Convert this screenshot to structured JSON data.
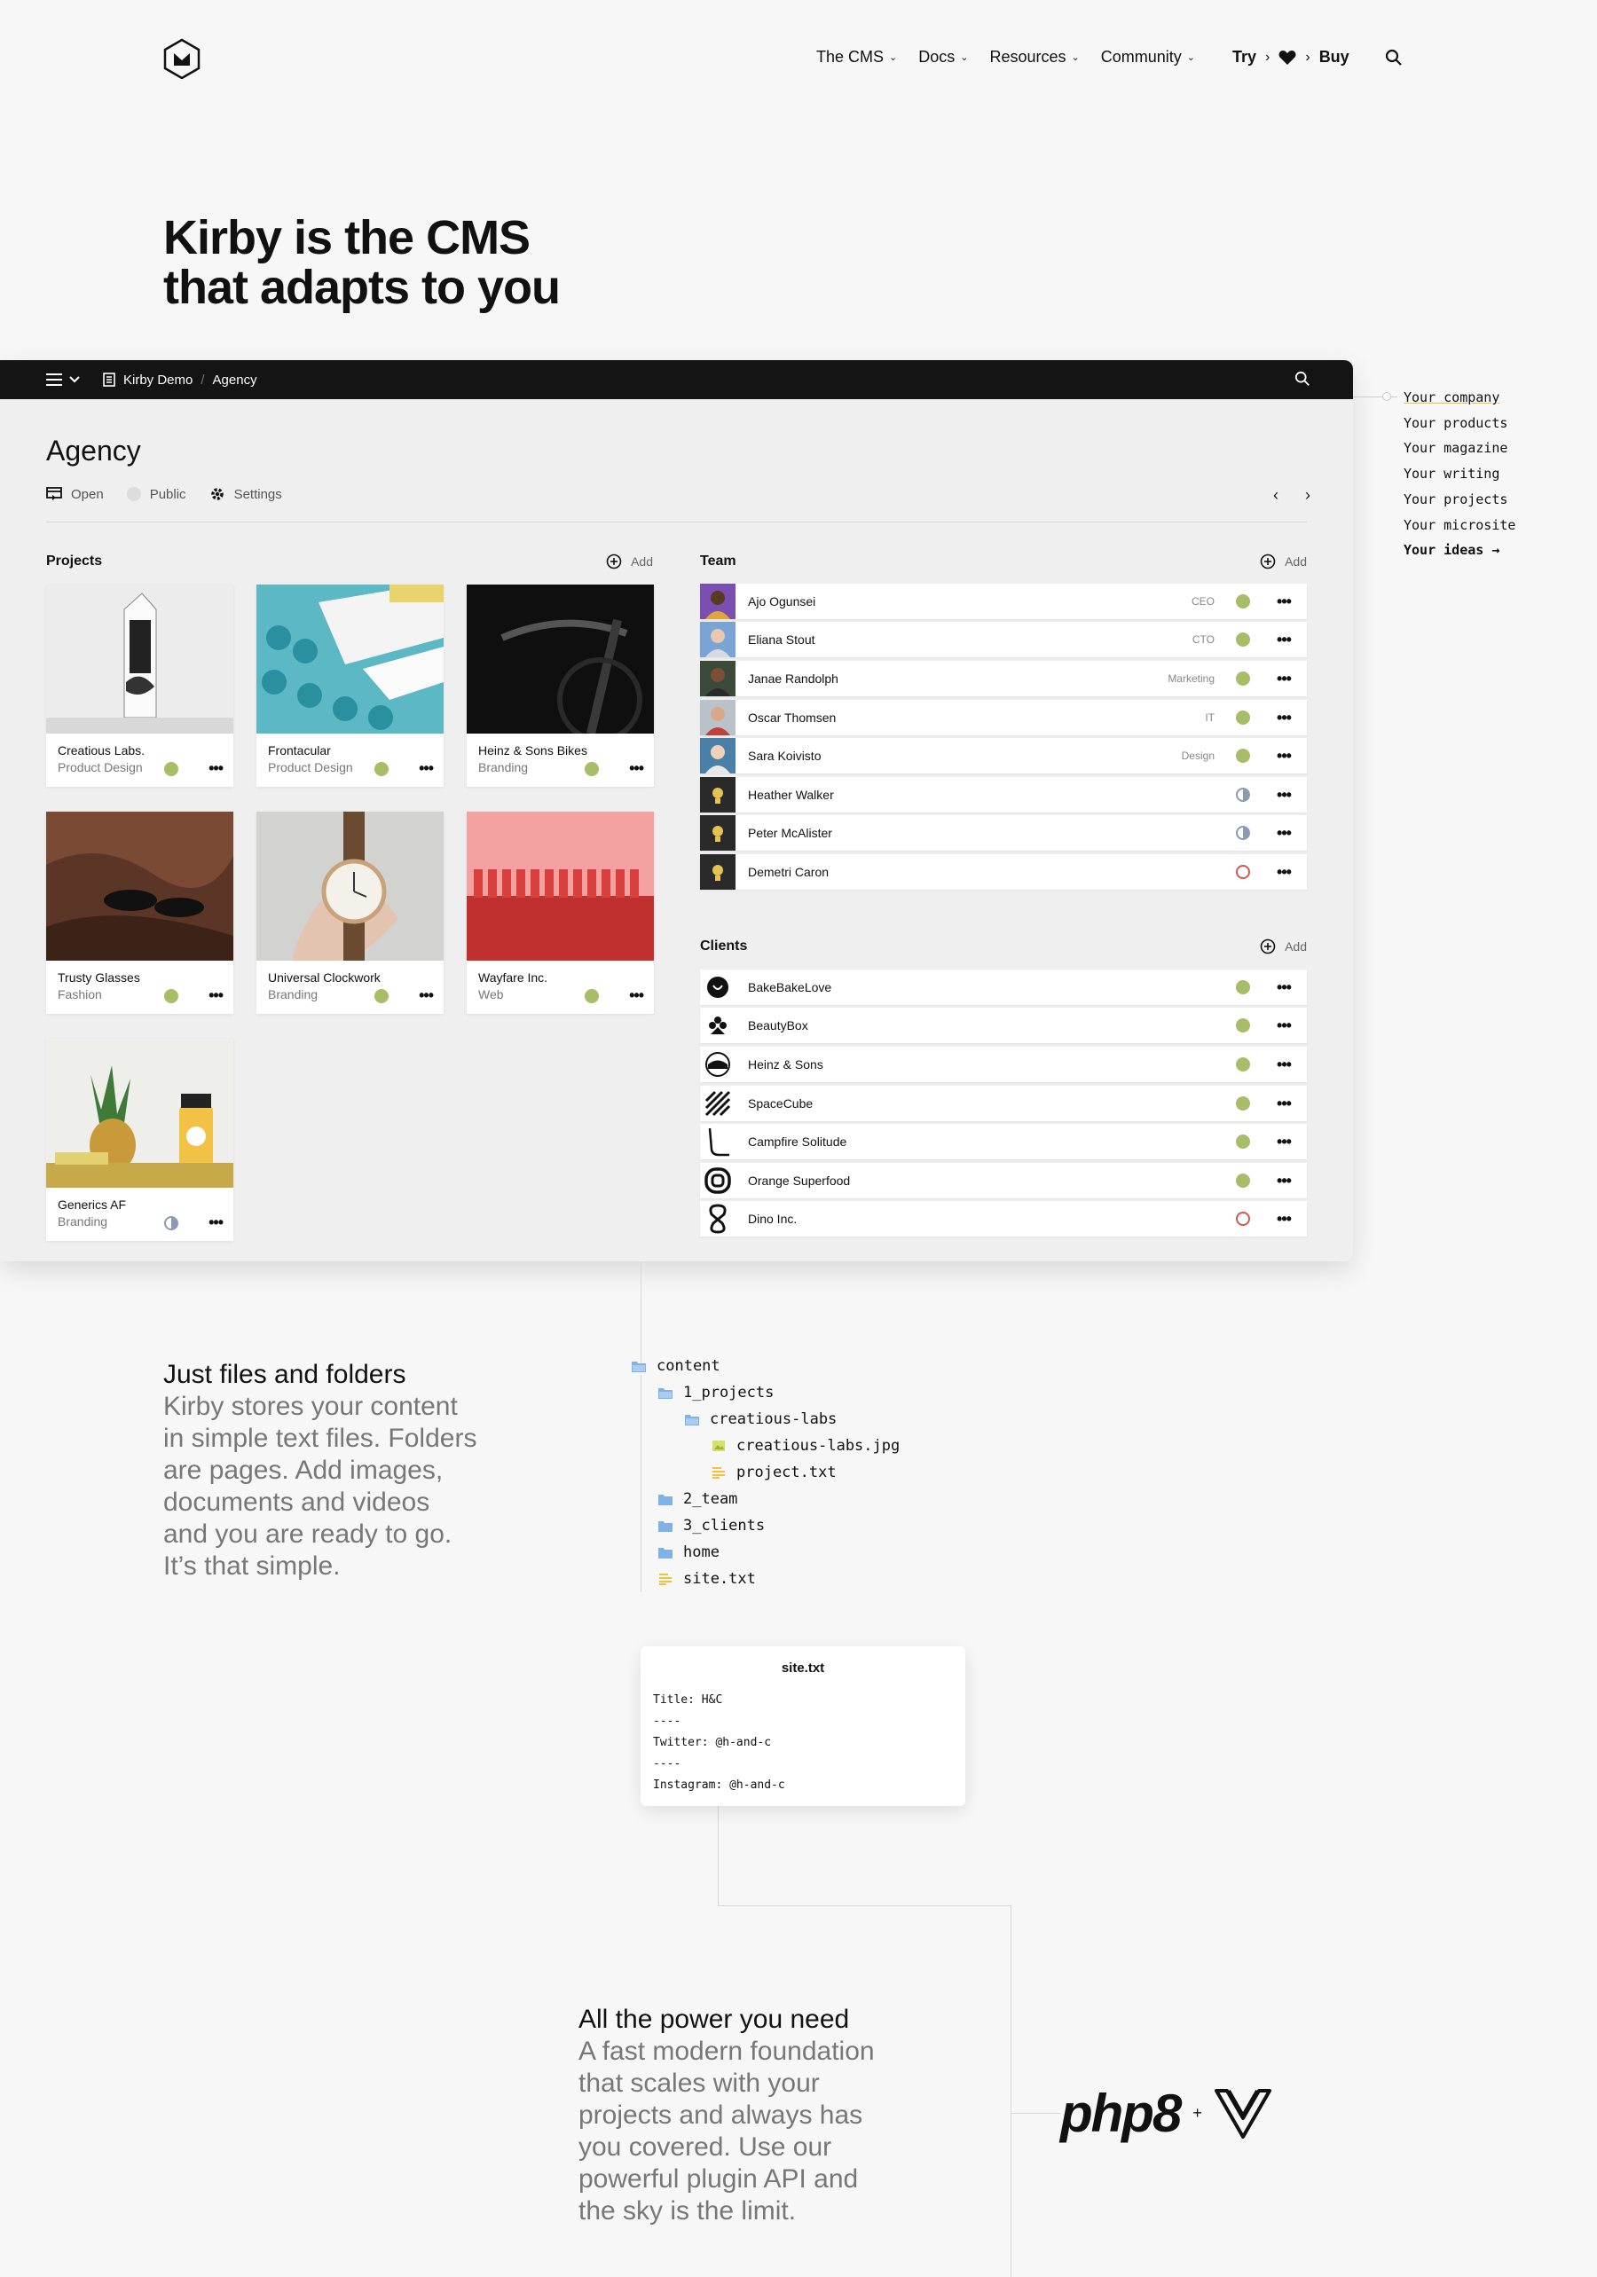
{
  "nav": {
    "items": [
      {
        "label": "The CMS"
      },
      {
        "label": "Docs"
      },
      {
        "label": "Resources"
      },
      {
        "label": "Community"
      }
    ],
    "try": "Try",
    "buy": "Buy"
  },
  "hero": {
    "line1": "Kirby is the CMS",
    "line2": "that adapts to you"
  },
  "panel": {
    "breadcrumb": [
      "Kirby Demo",
      "Agency"
    ],
    "title": "Agency",
    "actions": {
      "open": "Open",
      "public": "Public",
      "settings": "Settings"
    },
    "projects_heading": "Projects",
    "add_label": "Add",
    "projects": [
      {
        "title": "Creatious Labs.",
        "subtitle": "Product Design",
        "status": "listed"
      },
      {
        "title": "Frontacular",
        "subtitle": "Product Design",
        "status": "listed"
      },
      {
        "title": "Heinz & Sons Bikes",
        "subtitle": "Branding",
        "status": "listed"
      },
      {
        "title": "Trusty Glasses",
        "subtitle": "Fashion",
        "status": "listed"
      },
      {
        "title": "Universal Clockwork",
        "subtitle": "Branding",
        "status": "listed"
      },
      {
        "title": "Wayfare Inc.",
        "subtitle": "Web",
        "status": "listed"
      },
      {
        "title": "Generics AF",
        "subtitle": "Branding",
        "status": "unlisted"
      }
    ],
    "team_heading": "Team",
    "team": [
      {
        "name": "Ajo Ogunsei",
        "role": "CEO",
        "status": "listed"
      },
      {
        "name": "Eliana Stout",
        "role": "CTO",
        "status": "listed"
      },
      {
        "name": "Janae Randolph",
        "role": "Marketing",
        "status": "listed"
      },
      {
        "name": "Oscar Thomsen",
        "role": "IT",
        "status": "listed"
      },
      {
        "name": "Sara Koivisto",
        "role": "Design",
        "status": "listed"
      },
      {
        "name": "Heather Walker",
        "role": "",
        "status": "unlisted"
      },
      {
        "name": "Peter McAlister",
        "role": "",
        "status": "unlisted"
      },
      {
        "name": "Demetri Caron",
        "role": "",
        "status": "draft"
      }
    ],
    "clients_heading": "Clients",
    "clients": [
      {
        "name": "BakeBakeLove",
        "status": "listed"
      },
      {
        "name": "BeautyBox",
        "status": "listed"
      },
      {
        "name": "Heinz & Sons",
        "status": "listed"
      },
      {
        "name": "SpaceCube",
        "status": "listed"
      },
      {
        "name": "Campfire Solitude",
        "status": "listed"
      },
      {
        "name": "Orange Superfood",
        "status": "listed"
      },
      {
        "name": "Dino Inc.",
        "status": "draft"
      }
    ]
  },
  "side_words": [
    "Your company",
    "Your products",
    "Your magazine",
    "Your writing",
    "Your projects",
    "Your microsite",
    "Your ideas →"
  ],
  "files": {
    "heading": "Just files and folders",
    "body_lines": [
      "Kirby stores your content",
      "in simple text files. Folders",
      "are pages. Add images,",
      "documents and videos",
      "and you are ready to go.",
      "It’s that simple."
    ],
    "tree": [
      {
        "name": "content",
        "type": "folder"
      },
      {
        "name": "1_projects",
        "type": "folder"
      },
      {
        "name": "creatious-labs",
        "type": "folder"
      },
      {
        "name": "creatious-labs.jpg",
        "type": "image"
      },
      {
        "name": "project.txt",
        "type": "text"
      },
      {
        "name": "2_team",
        "type": "folder"
      },
      {
        "name": "3_clients",
        "type": "folder"
      },
      {
        "name": "home",
        "type": "folder"
      },
      {
        "name": "site.txt",
        "type": "text"
      }
    ],
    "sitetxt": {
      "title": "site.txt",
      "lines": [
        "Title: H&C",
        "----",
        "Twitter: @h-and-c",
        "----",
        "Instagram: @h-and-c"
      ]
    }
  },
  "power": {
    "heading": "All the power you need",
    "body_lines": [
      "A fast modern foundation",
      "that scales with your",
      "projects and always has",
      "you covered. Use our",
      "powerful plugin API and",
      "the sky is the limit."
    ],
    "logo_php": "php8",
    "logo_plus": "+"
  },
  "colors": {
    "listed": "#a7bd68",
    "unlisted": "#8a9bb2",
    "draft": "#d4574e",
    "bar": "#141414"
  }
}
